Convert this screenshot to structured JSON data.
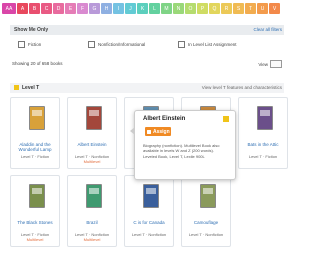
{
  "level_bar": [
    {
      "label": "AA",
      "color": "#d946a8"
    },
    {
      "label": "A",
      "color": "#e8485d"
    },
    {
      "label": "B",
      "color": "#e94f6f"
    },
    {
      "label": "C",
      "color": "#e95a84"
    },
    {
      "label": "D",
      "color": "#e86b9e"
    },
    {
      "label": "E",
      "color": "#e57cb6"
    },
    {
      "label": "F",
      "color": "#d98ad0"
    },
    {
      "label": "G",
      "color": "#b99ad9"
    },
    {
      "label": "H",
      "color": "#8fb0e2"
    },
    {
      "label": "I",
      "color": "#74c2e2"
    },
    {
      "label": "J",
      "color": "#62cbd4"
    },
    {
      "label": "K",
      "color": "#5ccfbd"
    },
    {
      "label": "L",
      "color": "#63d19f"
    },
    {
      "label": "M",
      "color": "#7fd486"
    },
    {
      "label": "N",
      "color": "#9ad879"
    },
    {
      "label": "O",
      "color": "#b5dc6e"
    },
    {
      "label": "P",
      "color": "#cfdc63"
    },
    {
      "label": "Q",
      "color": "#e2d65c"
    },
    {
      "label": "R",
      "color": "#ecc957"
    },
    {
      "label": "S",
      "color": "#f0bb53"
    },
    {
      "label": "T",
      "color": "#f2ac4f"
    },
    {
      "label": "U",
      "color": "#f39b4c"
    },
    {
      "label": "V",
      "color": "#f3894a"
    }
  ],
  "show_we_only": {
    "title": "Show Me Only",
    "clear_link": "Clear all filters"
  },
  "filters": [
    "Fiction",
    "Nonfiction/Informational",
    "In Level List Assignment"
  ],
  "showing_text": "Showing 20 of 658 books",
  "view_label": "View",
  "level_section": {
    "title": "Level T",
    "features_link": "View level T features and characteristics"
  },
  "books": [
    {
      "title": "Aladdin and the Wonderful Lamp",
      "meta": "Level T · Fiction",
      "note": "",
      "cover": "#d8a13a"
    },
    {
      "title": "Albert Einstein",
      "meta": "Level T · Nonfiction",
      "note": "Multilevel",
      "cover": "#a3473b"
    },
    {
      "title": "",
      "meta": "",
      "note": "",
      "cover": "#5f8fb0"
    },
    {
      "title": "",
      "meta": "",
      "note": "",
      "cover": "#c9883d"
    },
    {
      "title": "Bats in the Attic",
      "meta": "Level T · Fiction",
      "note": "",
      "cover": "#6b4f8a"
    },
    {
      "title": "The Black Stones",
      "meta": "Level T · Fiction",
      "note": "Multilevel",
      "cover": "#7a8f4c"
    },
    {
      "title": "Brazil",
      "meta": "Level T · Nonfiction",
      "note": "Multilevel",
      "cover": "#3f9a70"
    },
    {
      "title": "C is for Canada",
      "meta": "Level T · Nonfiction",
      "note": "",
      "cover": "#3a5f9c"
    },
    {
      "title": "Camouflage",
      "meta": "Level T · Nonfiction",
      "note": "",
      "cover": "#8a9a5b"
    }
  ],
  "tooltip": {
    "title": "Albert Einstein",
    "button": "Assign",
    "body": "Biography (nonfiction). Multilevel Book also available in levels W and Z (200 words). Leveled Book, Level T, Lexile 900L"
  }
}
